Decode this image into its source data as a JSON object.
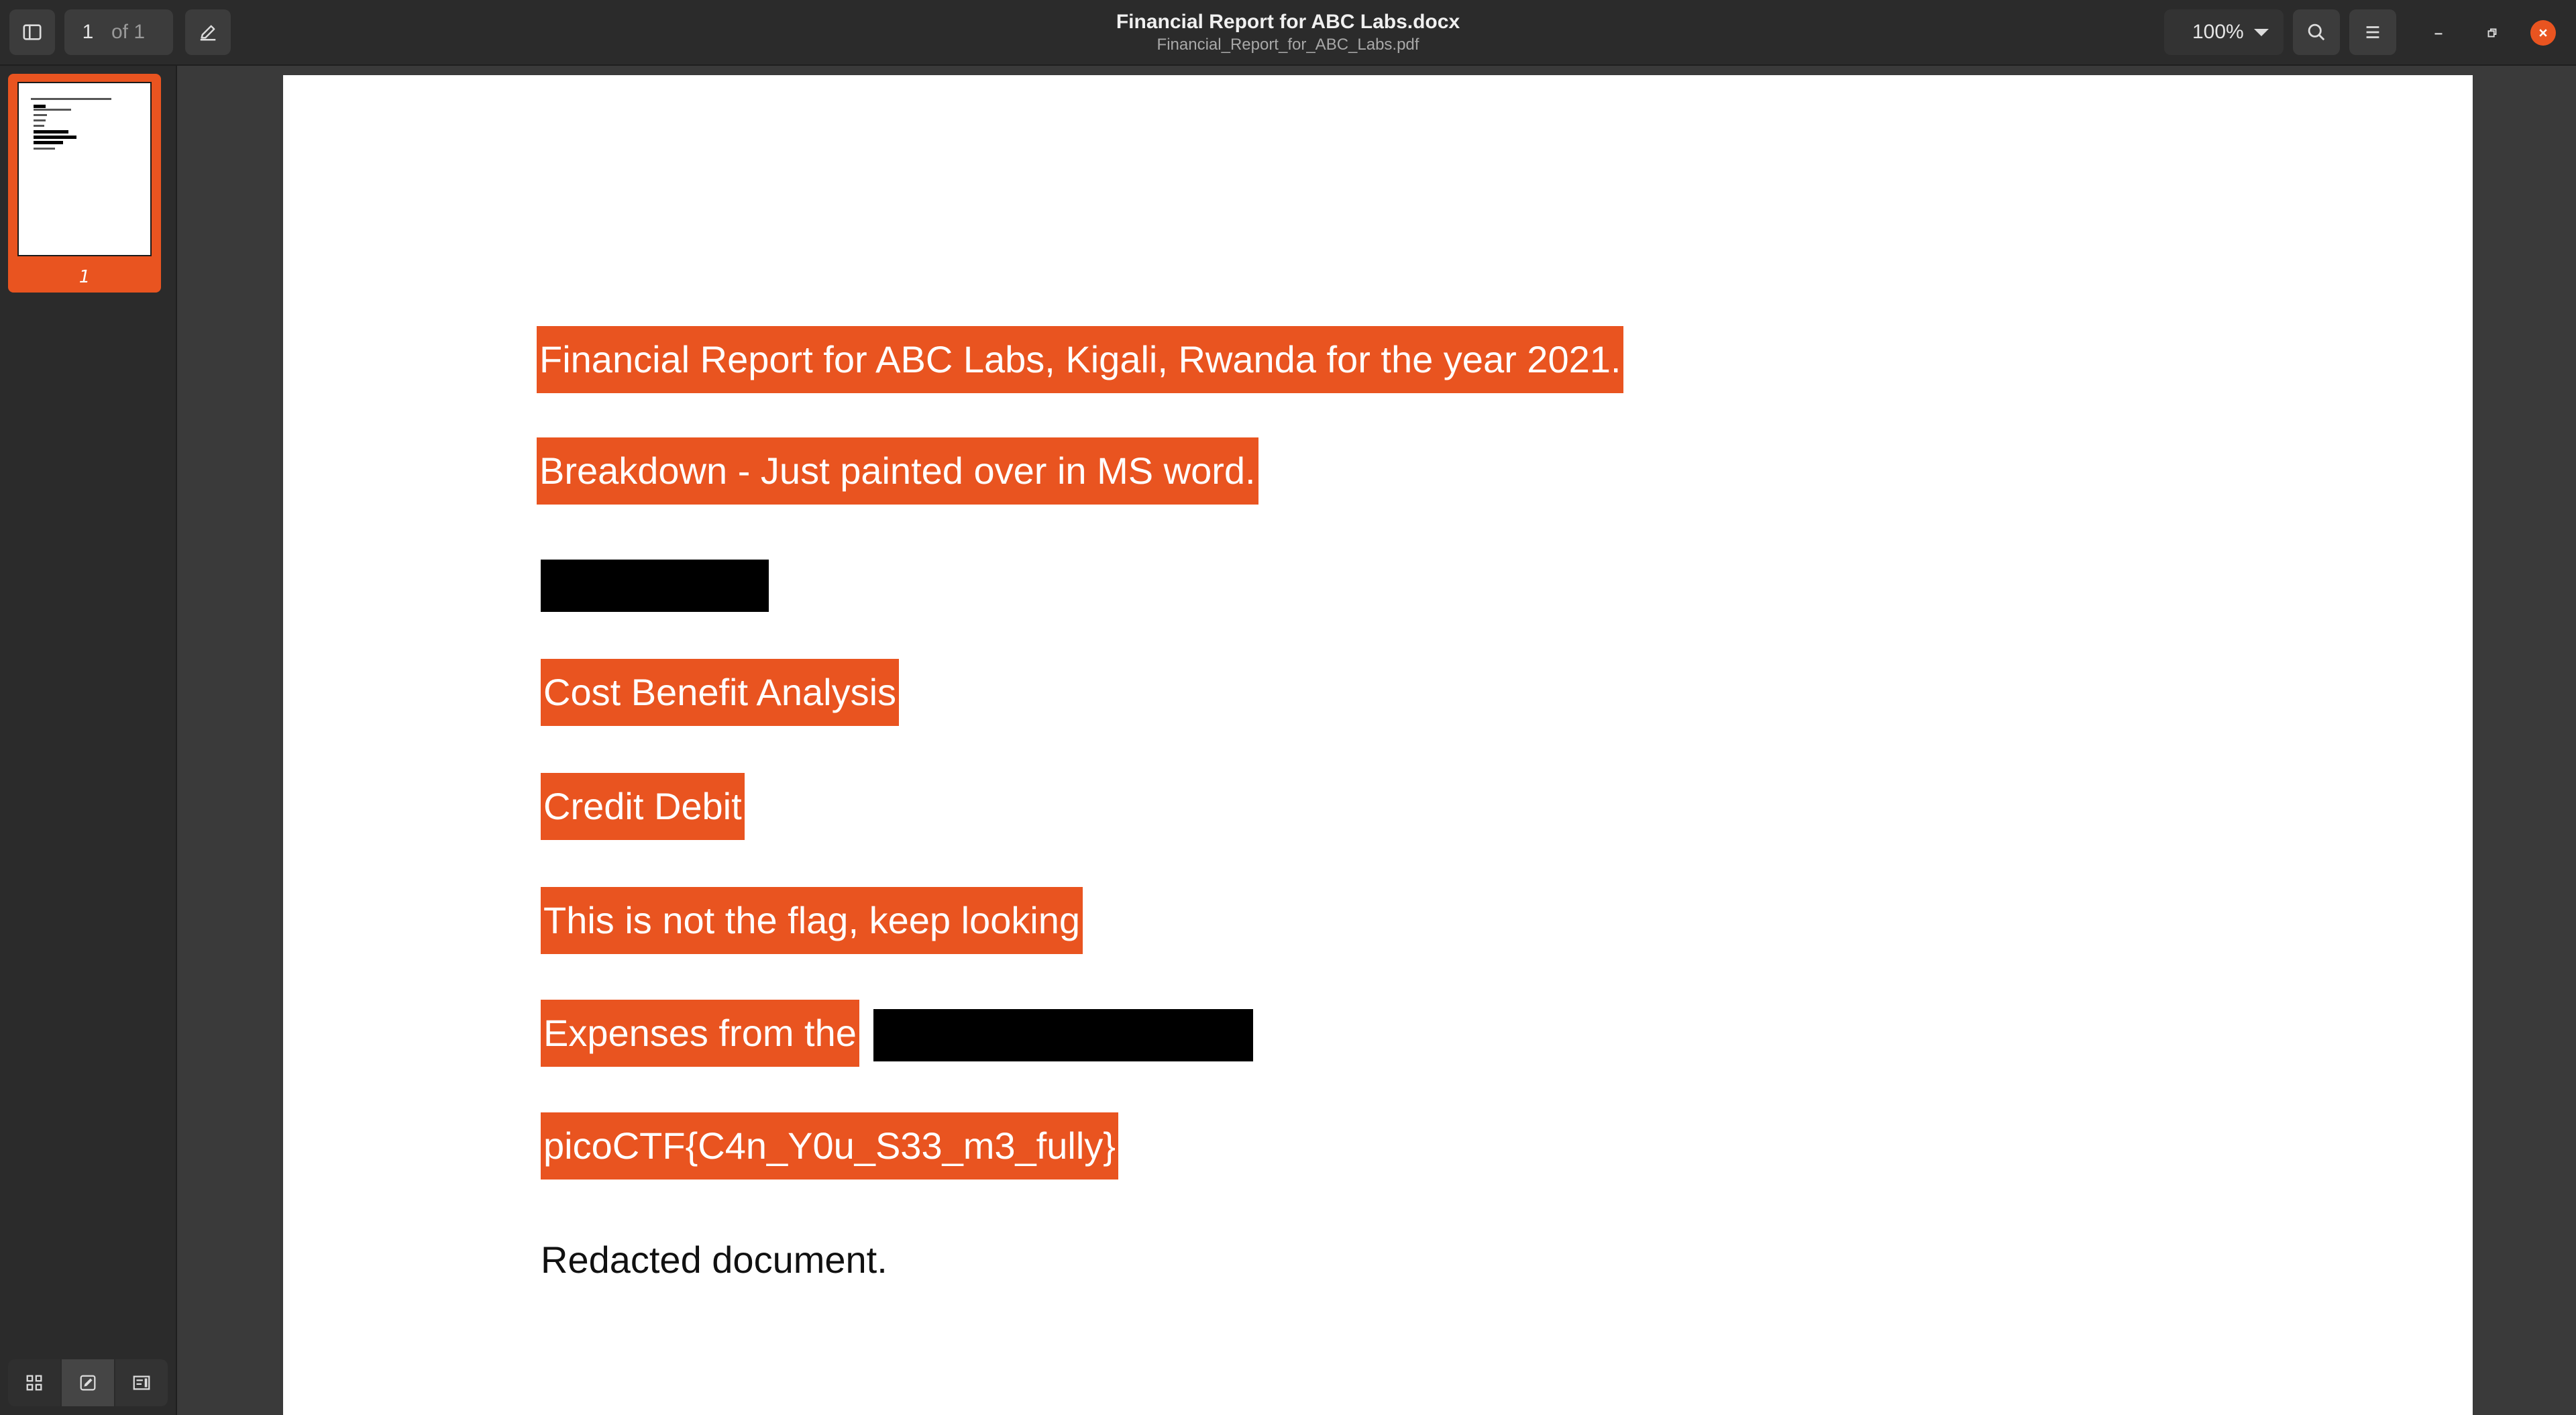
{
  "header": {
    "page_current": "1",
    "page_total": "of 1",
    "title": "Financial Report for ABC Labs.docx",
    "subtitle": "Financial_Report_for_ABC_Labs.pdf",
    "zoom": "100%",
    "icons": [
      "sidebar-toggle-icon",
      "annotate-pen-icon",
      "search-icon",
      "menu-icon",
      "minimize-icon",
      "restore-icon",
      "close-icon"
    ]
  },
  "sidebar": {
    "thumbnails": [
      {
        "label": "1"
      }
    ],
    "tools": [
      "thumbnails-grid-icon",
      "annotations-icon",
      "outline-icon"
    ]
  },
  "document": {
    "lines": [
      {
        "text": "Financial Report for ABC Labs, Kigali, Rwanda for the year 2021.",
        "style": "highlight"
      },
      {
        "text": "Breakdown - Just painted over in MS word.",
        "style": "highlight"
      },
      {
        "text": "",
        "style": "redacted"
      },
      {
        "text": "Cost Benefit Analysis",
        "style": "highlight"
      },
      {
        "text": "Credit Debit",
        "style": "highlight"
      },
      {
        "text": "This is not the flag, keep looking",
        "style": "highlight"
      },
      {
        "text": "Expenses from the",
        "style": "highlight-with-redaction"
      },
      {
        "text": "picoCTF{C4n_Y0u_S33_m3_fully}",
        "style": "highlight"
      },
      {
        "text": "Redacted document.",
        "style": "plain"
      }
    ]
  },
  "colors": {
    "accent": "#e95420",
    "headerbar": "#2b2b2b",
    "background": "#3a3a3a",
    "redaction": "#000000"
  }
}
